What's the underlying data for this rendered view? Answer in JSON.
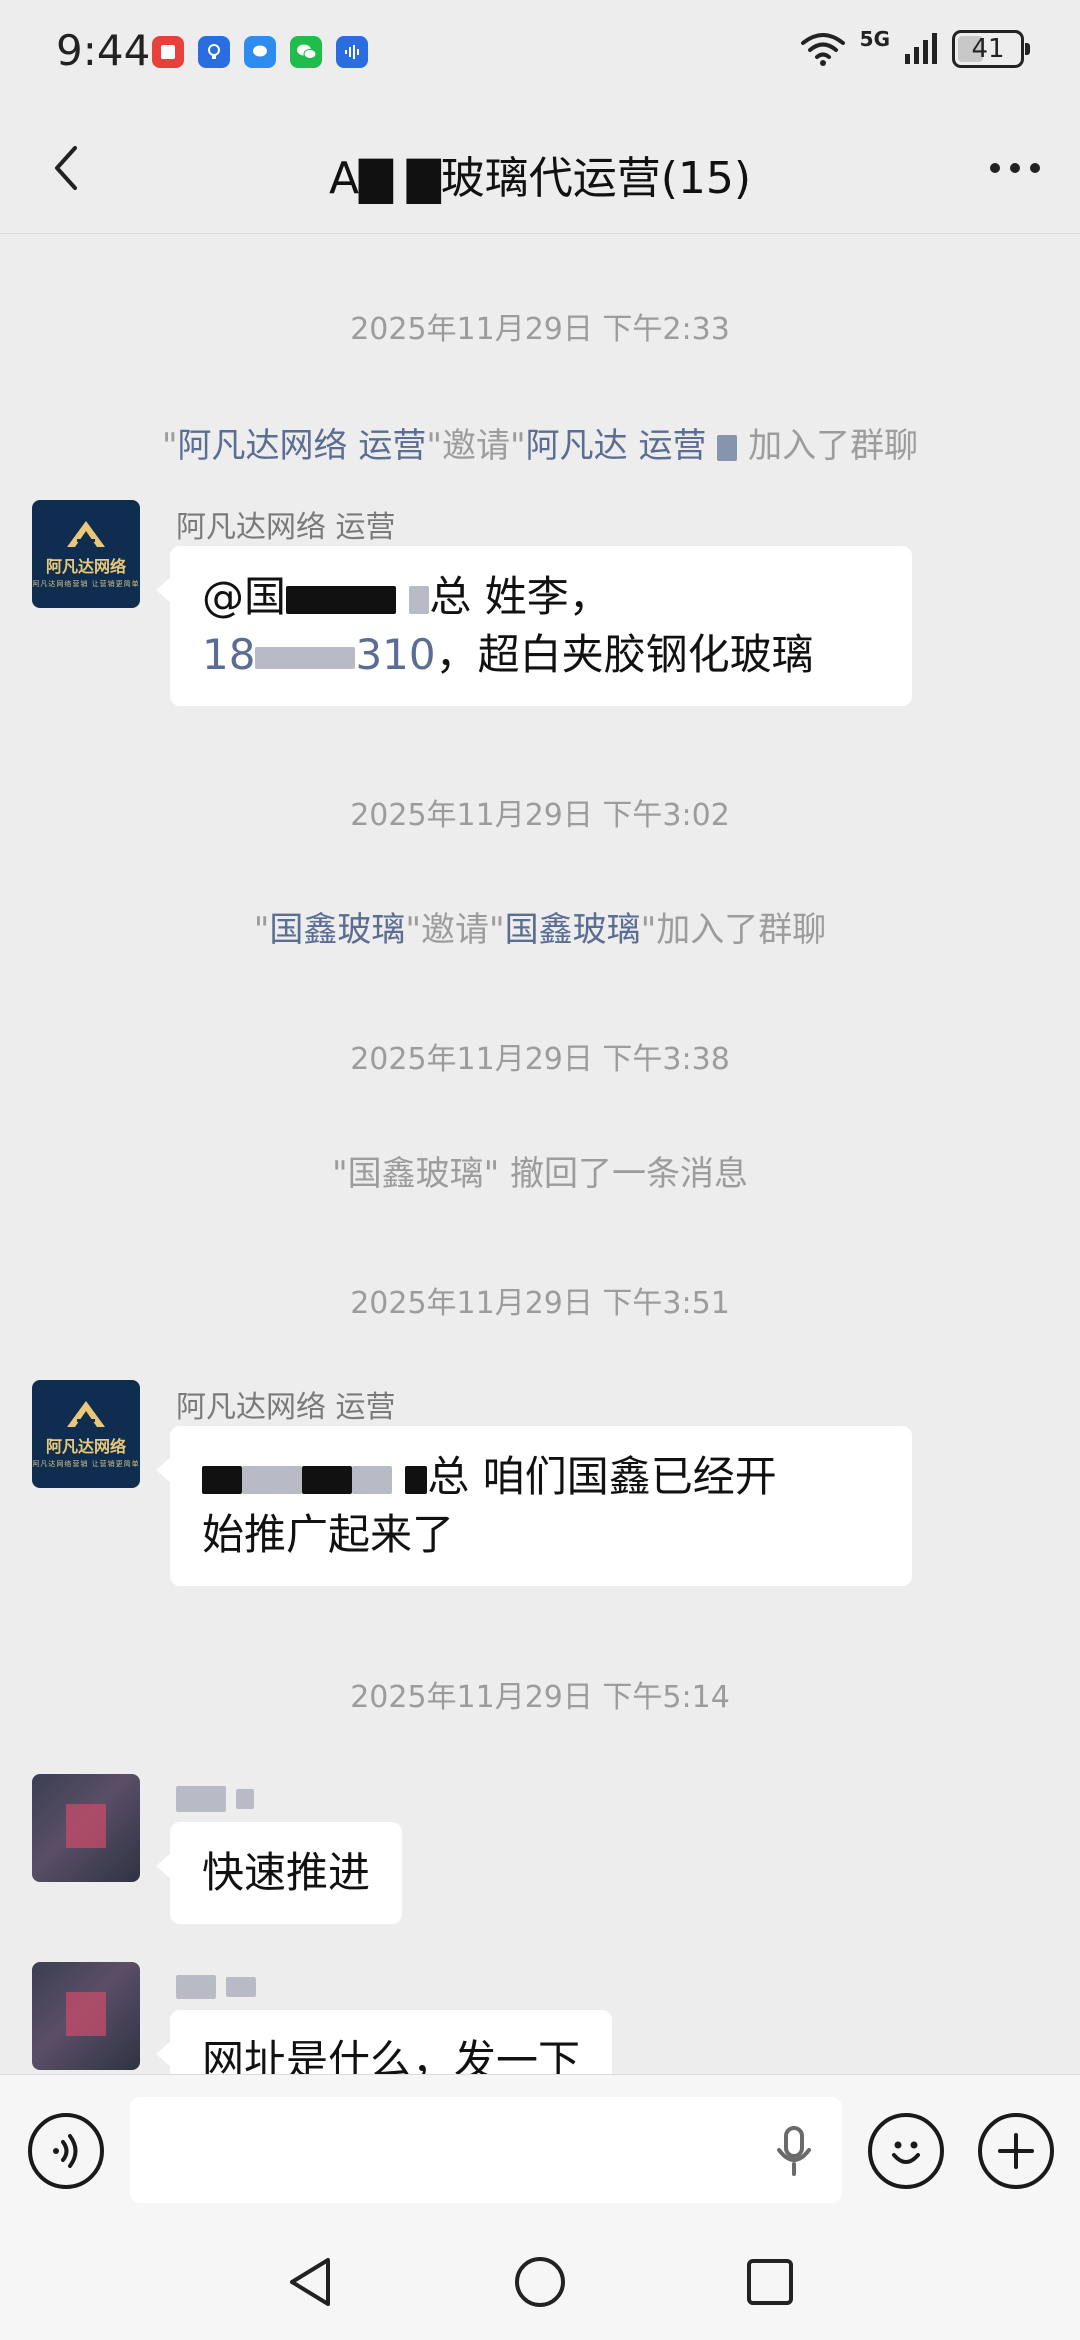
{
  "status_bar": {
    "time": "9:44",
    "network_label": "5G",
    "battery": "41",
    "notification_icons": [
      "red-book-app-icon",
      "bulb-app-icon",
      "message-app-icon",
      "wechat-app-icon",
      "voice-app-icon"
    ]
  },
  "header": {
    "title": "A▇ ▇玻璃代运营(15)"
  },
  "chat": {
    "items": [
      {
        "type": "timestamp",
        "text": "2025年11月29日 下午2:33"
      },
      {
        "type": "system",
        "q1": "\"",
        "actor": "阿凡达网络 运营",
        "verb": "\"邀请\"",
        "target": "阿凡达 运营",
        "suffix": "加入了群聊"
      },
      {
        "type": "message",
        "sender": "阿凡达网络 运营",
        "avatar_name": "阿凡达网络",
        "avatar_sub": "阿凡达网络营销 让营销更简单",
        "line1_prefix": "@国",
        "line1_suffix": "总 姓李，",
        "phone_a": "18",
        "phone_b": "310",
        "line2_suffix": "，超白夹胶钢化玻璃"
      },
      {
        "type": "timestamp",
        "text": "2025年11月29日 下午3:02"
      },
      {
        "type": "system",
        "q1": "\"",
        "actor": "国鑫玻璃",
        "verb": "\"邀请\"",
        "target": "国鑫玻璃",
        "suffix": "\"加入了群聊"
      },
      {
        "type": "timestamp",
        "text": "2025年11月29日 下午3:38"
      },
      {
        "type": "system_plain",
        "text": "\"国鑫玻璃\" 撤回了一条消息"
      },
      {
        "type": "timestamp",
        "text": "2025年11月29日 下午3:51"
      },
      {
        "type": "message",
        "sender": "阿凡达网络 运营",
        "avatar_name": "阿凡达网络",
        "avatar_sub": "阿凡达网络营销 让营销更简单",
        "line1_suffix": "总 咱们国鑫已经开",
        "line2": "始推广起来了"
      },
      {
        "type": "timestamp",
        "text": "2025年11月29日 下午5:14"
      },
      {
        "type": "message",
        "text": "快速推进"
      },
      {
        "type": "message",
        "text": "网址是什么，发一下"
      }
    ]
  },
  "input_bar": {
    "placeholder": ""
  }
}
